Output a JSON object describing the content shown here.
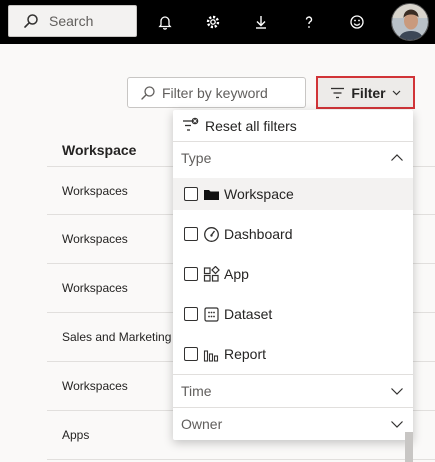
{
  "topbar": {
    "search_label": "Search",
    "icons": [
      "notification-bell-icon",
      "settings-gear-icon",
      "download-icon",
      "help-icon",
      "feedback-smiley-icon"
    ]
  },
  "filters": {
    "keyword_placeholder": "Filter by keyword",
    "filter_button_label": "Filter"
  },
  "table": {
    "column_header": "Workspace",
    "rows": [
      "Workspaces",
      "Workspaces",
      "Workspaces",
      "Sales and Marketing",
      "Workspaces",
      "Apps"
    ]
  },
  "dropdown": {
    "reset_label": "Reset all filters",
    "type_section": "Type",
    "type_options": [
      "Workspace",
      "Dashboard",
      "App",
      "Dataset",
      "Report"
    ],
    "time_section": "Time",
    "owner_section": "Owner"
  },
  "colors": {
    "highlight_border": "#d13438",
    "topbar": "#000000"
  }
}
